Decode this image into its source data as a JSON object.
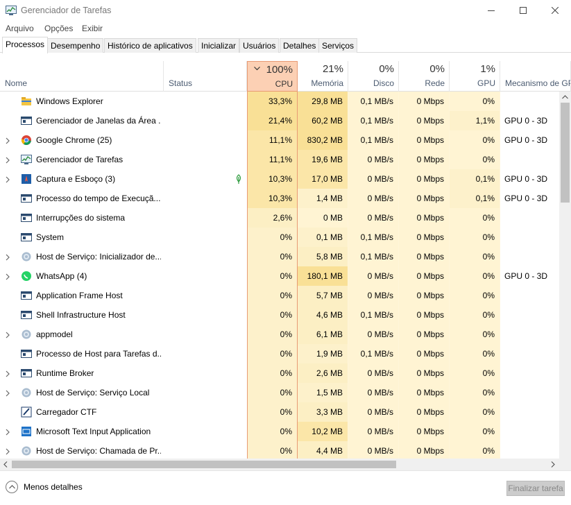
{
  "window": {
    "title": "Gerenciador de Tarefas"
  },
  "menu": [
    "Arquivo",
    "Opções",
    "Exibir"
  ],
  "tabs": [
    "Processos",
    "Desempenho",
    "Histórico de aplicativos",
    "Inicializar",
    "Usuários",
    "Detalhes",
    "Serviços"
  ],
  "columns": {
    "name": "Nome",
    "status": "Status",
    "cpu": {
      "pct": "100%",
      "label": "CPU"
    },
    "mem": {
      "pct": "21%",
      "label": "Memória"
    },
    "disk": {
      "pct": "0%",
      "label": "Disco"
    },
    "net": {
      "pct": "0%",
      "label": "Rede"
    },
    "gpu": {
      "pct": "1%",
      "label": "GPU"
    },
    "gpu_engine": "Mecanismo de GPU"
  },
  "rows": [
    {
      "name": "Windows Explorer",
      "cpu": "33,3%",
      "mem": "29,8 MB",
      "disk": "0,1 MB/s",
      "net": "0 Mbps",
      "gpu": "0%",
      "engine": "",
      "icon": "folder-icon",
      "expand": false,
      "leaf": false
    },
    {
      "name": "Gerenciador de Janelas da Área ...",
      "cpu": "21,4%",
      "mem": "60,2 MB",
      "disk": "0,1 MB/s",
      "net": "0 Mbps",
      "gpu": "1,1%",
      "engine": "GPU 0 - 3D",
      "icon": "window-icon",
      "expand": false,
      "leaf": false
    },
    {
      "name": "Google Chrome (25)",
      "cpu": "11,1%",
      "mem": "830,2 MB",
      "disk": "0,1 MB/s",
      "net": "0 Mbps",
      "gpu": "0%",
      "engine": "GPU 0 - 3D",
      "icon": "chrome-icon",
      "expand": true,
      "leaf": false
    },
    {
      "name": "Gerenciador de Tarefas",
      "cpu": "11,1%",
      "mem": "19,6 MB",
      "disk": "0 MB/s",
      "net": "0 Mbps",
      "gpu": "0%",
      "engine": "",
      "icon": "task-manager-icon",
      "expand": true,
      "leaf": false
    },
    {
      "name": "Captura e Esboço (3)",
      "cpu": "10,3%",
      "mem": "17,0 MB",
      "disk": "0 MB/s",
      "net": "0 Mbps",
      "gpu": "0,1%",
      "engine": "GPU 0 - 3D",
      "icon": "snip-icon",
      "expand": true,
      "leaf": true
    },
    {
      "name": "Processo do tempo de Execuçã...",
      "cpu": "10,3%",
      "mem": "1,4 MB",
      "disk": "0 MB/s",
      "net": "0 Mbps",
      "gpu": "0,1%",
      "engine": "GPU 0 - 3D",
      "icon": "window-icon",
      "expand": false,
      "leaf": false
    },
    {
      "name": "Interrupções do sistema",
      "cpu": "2,6%",
      "mem": "0 MB",
      "disk": "0 MB/s",
      "net": "0 Mbps",
      "gpu": "0%",
      "engine": "",
      "icon": "window-icon",
      "expand": false,
      "leaf": false
    },
    {
      "name": "System",
      "cpu": "0%",
      "mem": "0,1 MB",
      "disk": "0,1 MB/s",
      "net": "0 Mbps",
      "gpu": "0%",
      "engine": "",
      "icon": "window-icon",
      "expand": false,
      "leaf": false
    },
    {
      "name": "Host de Serviço: Inicializador de...",
      "cpu": "0%",
      "mem": "5,8 MB",
      "disk": "0,1 MB/s",
      "net": "0 Mbps",
      "gpu": "0%",
      "engine": "",
      "icon": "gear-icon",
      "expand": true,
      "leaf": false
    },
    {
      "name": "WhatsApp (4)",
      "cpu": "0%",
      "mem": "180,1 MB",
      "disk": "0 MB/s",
      "net": "0 Mbps",
      "gpu": "0%",
      "engine": "GPU 0 - 3D",
      "icon": "whatsapp-icon",
      "expand": true,
      "leaf": false
    },
    {
      "name": "Application Frame Host",
      "cpu": "0%",
      "mem": "5,7 MB",
      "disk": "0 MB/s",
      "net": "0 Mbps",
      "gpu": "0%",
      "engine": "",
      "icon": "window-icon",
      "expand": false,
      "leaf": false
    },
    {
      "name": "Shell Infrastructure Host",
      "cpu": "0%",
      "mem": "4,6 MB",
      "disk": "0,1 MB/s",
      "net": "0 Mbps",
      "gpu": "0%",
      "engine": "",
      "icon": "window-icon",
      "expand": false,
      "leaf": false
    },
    {
      "name": "appmodel",
      "cpu": "0%",
      "mem": "6,1 MB",
      "disk": "0 MB/s",
      "net": "0 Mbps",
      "gpu": "0%",
      "engine": "",
      "icon": "gear-icon",
      "expand": true,
      "leaf": false
    },
    {
      "name": "Processo de Host para Tarefas d...",
      "cpu": "0%",
      "mem": "1,9 MB",
      "disk": "0,1 MB/s",
      "net": "0 Mbps",
      "gpu": "0%",
      "engine": "",
      "icon": "window-icon",
      "expand": false,
      "leaf": false
    },
    {
      "name": "Runtime Broker",
      "cpu": "0%",
      "mem": "2,6 MB",
      "disk": "0 MB/s",
      "net": "0 Mbps",
      "gpu": "0%",
      "engine": "",
      "icon": "window-icon",
      "expand": true,
      "leaf": false
    },
    {
      "name": "Host de Serviço: Serviço Local",
      "cpu": "0%",
      "mem": "1,5 MB",
      "disk": "0 MB/s",
      "net": "0 Mbps",
      "gpu": "0%",
      "engine": "",
      "icon": "gear-icon",
      "expand": true,
      "leaf": false
    },
    {
      "name": "Carregador CTF",
      "cpu": "0%",
      "mem": "3,3 MB",
      "disk": "0 MB/s",
      "net": "0 Mbps",
      "gpu": "0%",
      "engine": "",
      "icon": "pen-icon",
      "expand": false,
      "leaf": false
    },
    {
      "name": "Microsoft Text Input Application",
      "cpu": "0%",
      "mem": "10,2 MB",
      "disk": "0 MB/s",
      "net": "0 Mbps",
      "gpu": "0%",
      "engine": "",
      "icon": "keyboard-icon",
      "expand": true,
      "leaf": false
    },
    {
      "name": "Host de Serviço: Chamada de Pr...",
      "cpu": "0%",
      "mem": "4,4 MB",
      "disk": "0 MB/s",
      "net": "0 Mbps",
      "gpu": "0%",
      "engine": "",
      "icon": "gear-icon",
      "expand": true,
      "leaf": false
    }
  ],
  "footer": {
    "less_details": "Menos detalhes",
    "end_task": "Finalizar tarefa"
  }
}
